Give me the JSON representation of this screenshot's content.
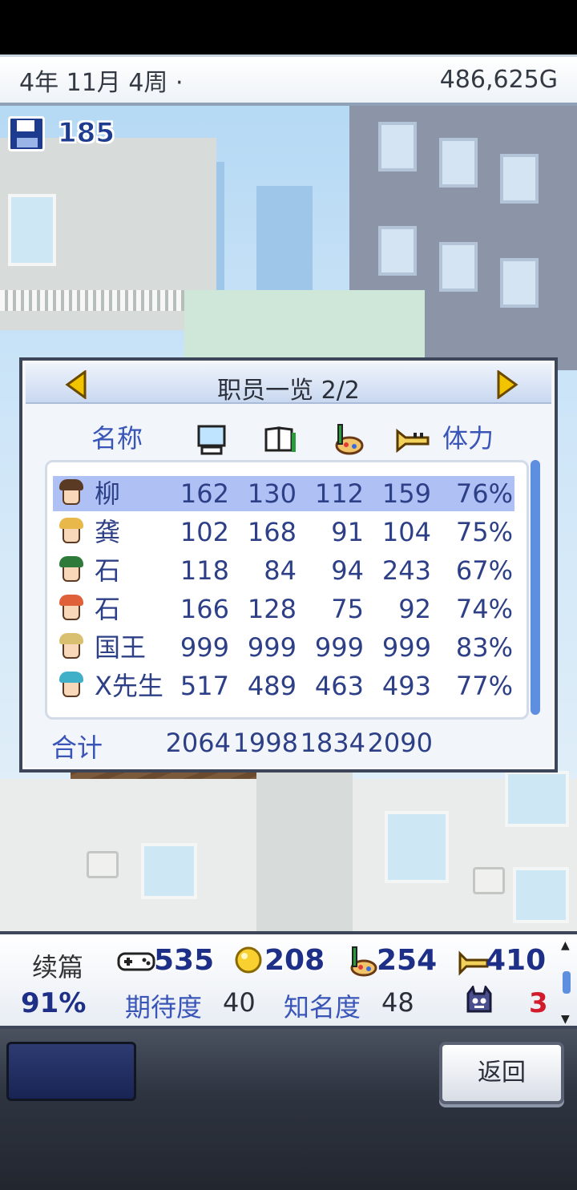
{
  "status": {
    "date": "4年 11月 4周 ·",
    "money": "486,625G"
  },
  "save": {
    "icon": "floppy-disk-icon",
    "count": "185"
  },
  "staff_panel": {
    "title": "职员一览 2/2",
    "columns": {
      "name": "名称",
      "programming_icon": "computer-icon",
      "scenario_icon": "book-icon",
      "graphics_icon": "paint-brush-icon",
      "sound_icon": "trumpet-icon",
      "stamina": "体力"
    },
    "rows": [
      {
        "name": "柳",
        "programming": "162",
        "scenario": "130",
        "graphics": "112",
        "sound": "159",
        "stamina": "76%",
        "selected": true,
        "hair": "#5a3a22"
      },
      {
        "name": "龚",
        "programming": "102",
        "scenario": "168",
        "graphics": "91",
        "sound": "104",
        "stamina": "75%",
        "selected": false,
        "hair": "#e8b84a"
      },
      {
        "name": "石",
        "programming": "118",
        "scenario": "84",
        "graphics": "94",
        "sound": "243",
        "stamina": "67%",
        "selected": false,
        "hair": "#2d7a3a"
      },
      {
        "name": "石",
        "programming": "166",
        "scenario": "128",
        "graphics": "75",
        "sound": "92",
        "stamina": "74%",
        "selected": false,
        "hair": "#e0603a"
      },
      {
        "name": "国王",
        "programming": "999",
        "scenario": "999",
        "graphics": "999",
        "sound": "999",
        "stamina": "83%",
        "selected": false,
        "hair": "#d9c070"
      },
      {
        "name": "X先生",
        "programming": "517",
        "scenario": "489",
        "graphics": "463",
        "sound": "493",
        "stamina": "77%",
        "selected": false,
        "hair": "#3fb0c8"
      }
    ],
    "total_label": "合计",
    "totals": [
      "2064",
      "1998",
      "1834",
      "2090"
    ]
  },
  "game_info": {
    "genre": "续篇",
    "fun": "535",
    "creativity": "208",
    "graphics": "254",
    "sound": "410",
    "progress": "91%",
    "expectation_label": "期待度",
    "expectation_value": "40",
    "fame_label": "知名度",
    "fame_value": "48",
    "bug_count": "3"
  },
  "footer": {
    "back_label": "返回"
  }
}
